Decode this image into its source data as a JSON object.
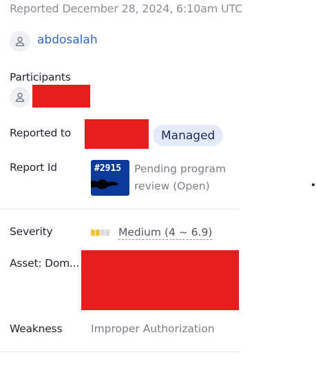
{
  "reported": "Reported December 28, 2024, 6:10am UTC",
  "reporter": {
    "name": "abdosalah",
    "avatar_icon": "user-icon"
  },
  "participants": {
    "label": "Participants",
    "avatar_icon": "user-icon",
    "name_redacted": true
  },
  "reported_to": {
    "label": "Reported to",
    "name_redacted": true,
    "badge": "Managed"
  },
  "report_id": {
    "label": "Report Id",
    "id_badge": "#2915",
    "status": "Pending program review (Open)"
  },
  "severity": {
    "label": "Severity",
    "value": "Medium (4 ~ 6.9)",
    "level": 2,
    "max_level": 4,
    "colors": {
      "active": "#f4c23f",
      "inactive": "#d9dbe0"
    }
  },
  "asset": {
    "label": "Asset: Dom...",
    "value_redacted": true
  },
  "weakness": {
    "label": "Weakness",
    "value": "Improper Authorization"
  },
  "colors": {
    "link": "#2f67d3",
    "muted": "#7a7e88",
    "redaction": "#e51d1d",
    "badge_bg": "#e3ebfa",
    "logo_bg": "#0b3a9a"
  }
}
